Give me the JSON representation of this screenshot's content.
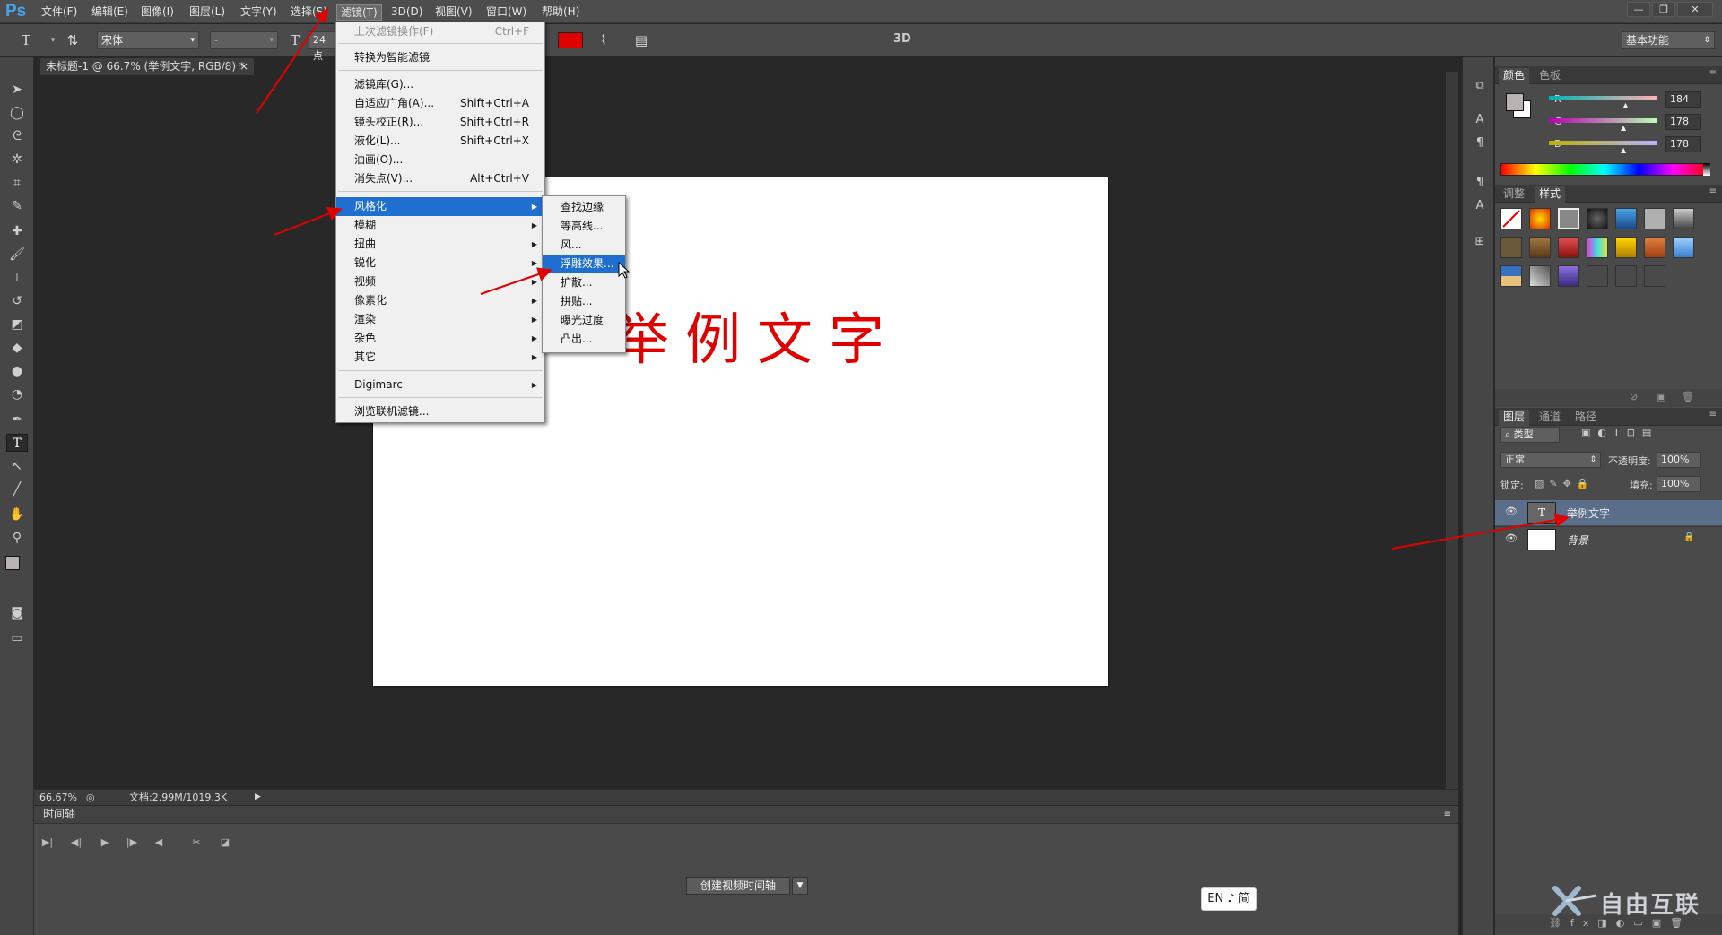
{
  "app": {
    "logo": "Ps",
    "menus": [
      "文件(F)",
      "编辑(E)",
      "图像(I)",
      "图层(L)",
      "文字(Y)",
      "选择(S)",
      "滤镜(T)",
      "3D(D)",
      "视图(V)",
      "窗口(W)",
      "帮助(H)"
    ],
    "active_menu": "滤镜(T)",
    "window_controls": [
      "—",
      "❐",
      "✕"
    ]
  },
  "options_bar": {
    "font_family": "宋体",
    "font_style": "-",
    "font_size": "24点",
    "text_color": "#e00000",
    "label_3d": "3D",
    "workspace": "基本功能"
  },
  "document": {
    "tab_title": "未标题-1 @ 66.7% (举例文字, RGB/8) *",
    "canvas_text": "举例文字",
    "canvas_text_color": "#e00000"
  },
  "status": {
    "zoom": "66.67%",
    "doc_info": "文档:2.99M/1019.3K"
  },
  "timeline": {
    "title": "时间轴",
    "create_button": "创建视频时间轴"
  },
  "ime": {
    "text": "EN ♪ 简"
  },
  "filter_menu": {
    "items": [
      {
        "label": "上次滤镜操作(F)",
        "shortcut": "Ctrl+F",
        "disabled": true
      },
      {
        "label": "转换为智能滤镜",
        "shortcut": ""
      },
      {
        "label": "滤镜库(G)...",
        "shortcut": ""
      },
      {
        "label": "自适应广角(A)...",
        "shortcut": "Shift+Ctrl+A"
      },
      {
        "label": "镜头校正(R)...",
        "shortcut": "Shift+Ctrl+R"
      },
      {
        "label": "液化(L)...",
        "shortcut": "Shift+Ctrl+X"
      },
      {
        "label": "油画(O)...",
        "shortcut": ""
      },
      {
        "label": "消失点(V)...",
        "shortcut": "Alt+Ctrl+V"
      },
      {
        "label": "风格化",
        "submenu": true,
        "highlighted": true
      },
      {
        "label": "模糊",
        "submenu": true
      },
      {
        "label": "扭曲",
        "submenu": true
      },
      {
        "label": "锐化",
        "submenu": true
      },
      {
        "label": "视频",
        "submenu": true
      },
      {
        "label": "像素化",
        "submenu": true
      },
      {
        "label": "渲染",
        "submenu": true
      },
      {
        "label": "杂色",
        "submenu": true
      },
      {
        "label": "其它",
        "submenu": true
      },
      {
        "label": "Digimarc",
        "submenu": true
      },
      {
        "label": "浏览联机滤镜..."
      }
    ]
  },
  "stylize_submenu": {
    "items": [
      {
        "label": "查找边缘"
      },
      {
        "label": "等高线..."
      },
      {
        "label": "风..."
      },
      {
        "label": "浮雕效果...",
        "highlighted": true
      },
      {
        "label": "扩散..."
      },
      {
        "label": "拼贴..."
      },
      {
        "label": "曝光过度"
      },
      {
        "label": "凸出..."
      }
    ]
  },
  "color_panel": {
    "tabs": [
      "颜色",
      "色板"
    ],
    "channels": [
      {
        "label": "R",
        "value": "184",
        "fraction": 0.72
      },
      {
        "label": "G",
        "value": "178",
        "fraction": 0.7
      },
      {
        "label": "B",
        "value": "178",
        "fraction": 0.7
      }
    ],
    "foreground": "#b8b2b2"
  },
  "styles_panel": {
    "tabs": [
      "调整",
      "样式"
    ]
  },
  "layers_panel": {
    "tabs": [
      "图层",
      "通道",
      "路径"
    ],
    "filter_kind": "类型",
    "blend_mode": "正常",
    "opacity_label": "不透明度:",
    "opacity": "100%",
    "lock_label": "锁定:",
    "fill_label": "填充:",
    "fill": "100%",
    "layers": [
      {
        "name": "举例文字",
        "type": "text",
        "selected": true
      },
      {
        "name": "背景",
        "type": "background",
        "locked": true
      }
    ]
  },
  "watermark": {
    "text": "自由互联"
  }
}
